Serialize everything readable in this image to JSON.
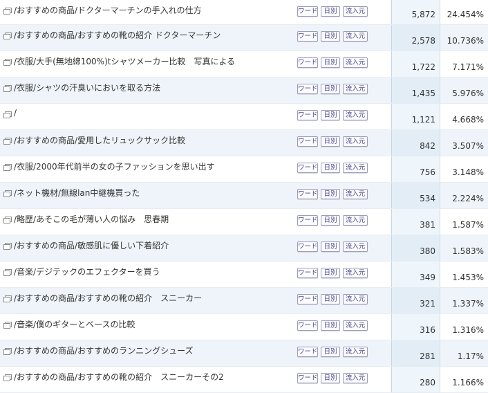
{
  "buttons": {
    "word": "ワード",
    "daily": "日別",
    "source": "流入元"
  },
  "rows": [
    {
      "title": "/おすすめの商品/ドクターマーチンの手入れの仕方",
      "pv": "5,872",
      "pct": "24.454%"
    },
    {
      "title": "/おすすめの商品/おすすめの靴の紹介 ドクターマーチン",
      "pv": "2,578",
      "pct": "10.736%"
    },
    {
      "title": "/衣服/大手(無地綿100%)tシャツメーカー比較　写真による",
      "pv": "1,722",
      "pct": "7.171%"
    },
    {
      "title": "/衣服/シャツの汗臭いにおいを取る方法",
      "pv": "1,435",
      "pct": "5.976%"
    },
    {
      "title": "/",
      "pv": "1,121",
      "pct": "4.668%"
    },
    {
      "title": "/おすすめの商品/愛用したリュックサック比較",
      "pv": "842",
      "pct": "3.507%"
    },
    {
      "title": "/衣服/2000年代前半の女の子ファッションを思い出す",
      "pv": "756",
      "pct": "3.148%"
    },
    {
      "title": "/ネット機材/無線lan中継機買った",
      "pv": "534",
      "pct": "2.224%"
    },
    {
      "title": "/略歴/あそこの毛が薄い人の悩み　思春期",
      "pv": "381",
      "pct": "1.587%"
    },
    {
      "title": "/おすすめの商品/敏感肌に優しい下着紹介",
      "pv": "380",
      "pct": "1.583%"
    },
    {
      "title": "/音楽/デジテックのエフェクターを買う",
      "pv": "349",
      "pct": "1.453%"
    },
    {
      "title": "/おすすめの商品/おすすめの靴の紹介　スニーカー",
      "pv": "321",
      "pct": "1.337%"
    },
    {
      "title": "/音楽/僕のギターとベースの比較",
      "pv": "316",
      "pct": "1.316%"
    },
    {
      "title": "/おすすめの商品/おすすめのランニングシューズ",
      "pv": "281",
      "pct": "1.17%"
    },
    {
      "title": "/おすすめの商品/おすすめの靴の紹介　スニーカーその2",
      "pv": "280",
      "pct": "1.166%"
    }
  ]
}
